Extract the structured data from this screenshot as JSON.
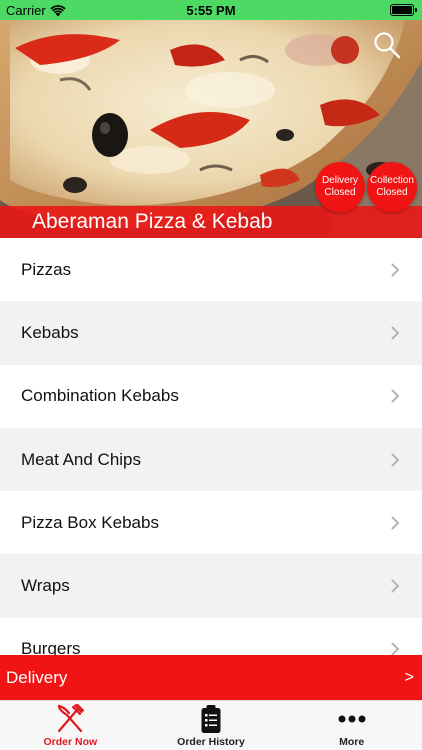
{
  "status_bar": {
    "carrier": "Carrier",
    "time": "5:55 PM"
  },
  "restaurant": {
    "name": "Aberaman Pizza & Kebab"
  },
  "badges": {
    "delivery": {
      "line1": "Delivery",
      "line2": "Closed"
    },
    "collection": {
      "line1": "Collection",
      "line2": "Closed"
    }
  },
  "menu": {
    "items": [
      {
        "label": "Pizzas"
      },
      {
        "label": "Kebabs"
      },
      {
        "label": "Combination Kebabs"
      },
      {
        "label": "Meat And Chips"
      },
      {
        "label": "Pizza Box Kebabs"
      },
      {
        "label": "Wraps"
      },
      {
        "label": "Burgers"
      }
    ]
  },
  "delivery_bar": {
    "label": "Delivery",
    "arrow": ">"
  },
  "tabs": [
    {
      "label": "Order Now",
      "icon": "fork-knife-icon"
    },
    {
      "label": "Order History",
      "icon": "clipboard-list-icon"
    },
    {
      "label": "More",
      "icon": "ellipsis-icon"
    }
  ],
  "colors": {
    "accent": "#f01414",
    "status_bar": "#4cd964"
  }
}
